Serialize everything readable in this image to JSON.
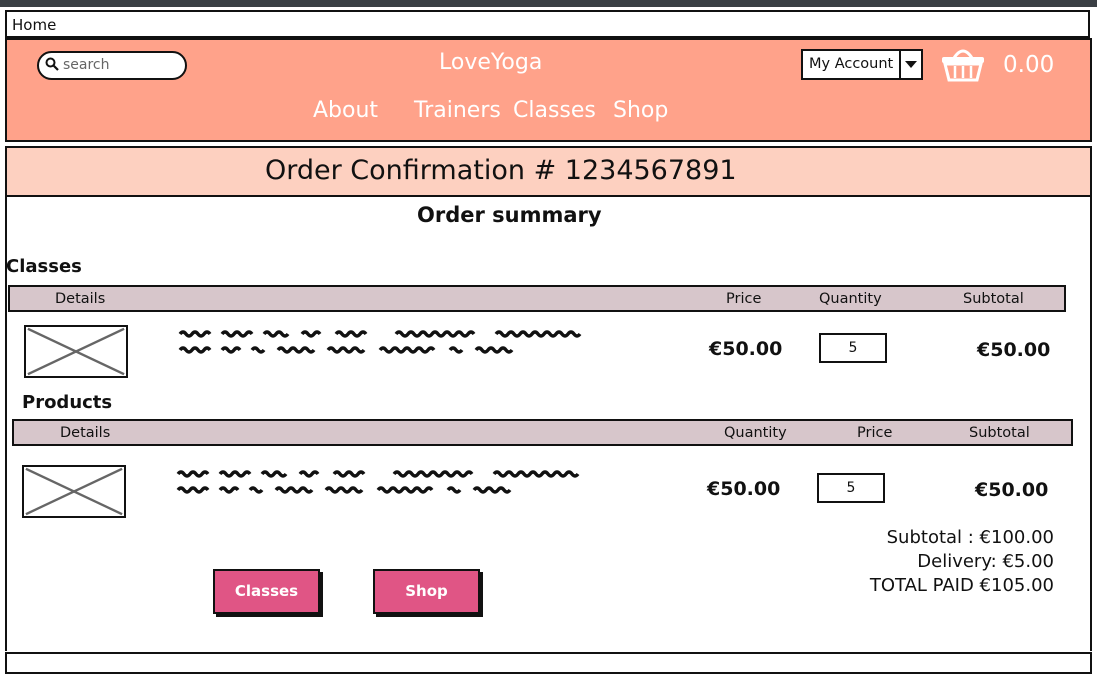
{
  "home": {
    "label": "Home"
  },
  "header": {
    "search_placeholder": "search",
    "brand": "LoveYoga",
    "nav": [
      "About",
      "Trainers",
      "Classes",
      "Shop"
    ],
    "account_label": "My Account",
    "cart_total": "0.00"
  },
  "confirmation": {
    "title": "Order Confirmation # 1234567891"
  },
  "summary": {
    "title": "Order summary"
  },
  "classes": {
    "title": "Classes",
    "headers": {
      "details": "Details",
      "price": "Price",
      "quantity": "Quantity",
      "subtotal": "Subtotal"
    },
    "row": {
      "price": "€50.00",
      "qty": "5",
      "subtotal": "€50.00"
    }
  },
  "products": {
    "title": "Products",
    "headers": {
      "details": "Details",
      "quantity": "Quantity",
      "price": "Price",
      "subtotal": "Subtotal"
    },
    "row": {
      "price": "€50.00",
      "qty": "5",
      "subtotal": "€50.00"
    }
  },
  "totals": {
    "subtotal": "Subtotal : €100.00",
    "delivery": "Delivery: €5.00",
    "total_paid": "TOTAL PAID €105.00"
  },
  "buttons": {
    "classes": "Classes",
    "shop": "Shop"
  },
  "colors": {
    "header": "#ffa28a",
    "confirm_bar": "#fdd0c0",
    "table_header": "#d7c6cb",
    "button": "#e05585"
  },
  "icons": {
    "search": "search-icon",
    "cart": "basket-icon",
    "dropdown": "caret-down-icon",
    "image": "image-placeholder-icon"
  }
}
